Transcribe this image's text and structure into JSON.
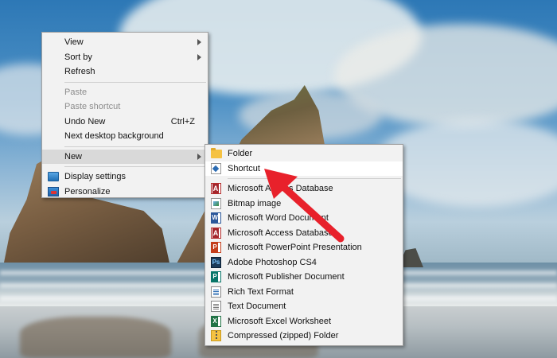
{
  "context_menu": {
    "items": [
      {
        "label": "View",
        "submenu": true
      },
      {
        "label": "Sort by",
        "submenu": true
      },
      {
        "label": "Refresh"
      },
      {
        "label": "Paste",
        "disabled": true
      },
      {
        "label": "Paste shortcut",
        "disabled": true
      },
      {
        "label": "Undo New",
        "shortcut": "Ctrl+Z"
      },
      {
        "label": "Next desktop background"
      },
      {
        "label": "New",
        "submenu": true,
        "highlighted": true
      },
      {
        "label": "Display settings",
        "icon": "display-settings-icon"
      },
      {
        "label": "Personalize",
        "icon": "personalize-icon"
      }
    ]
  },
  "new_submenu": {
    "items": [
      {
        "label": "Folder",
        "icon": "folder-icon"
      },
      {
        "label": "Shortcut",
        "icon": "shortcut-icon",
        "highlighted": true
      },
      {
        "label": "Microsoft Access Database",
        "icon": "access-database-icon"
      },
      {
        "label": "Bitmap image",
        "icon": "bitmap-image-icon"
      },
      {
        "label": "Microsoft Word Document",
        "icon": "word-document-icon"
      },
      {
        "label": "Microsoft Access Database",
        "icon": "access-database-icon"
      },
      {
        "label": "Microsoft PowerPoint Presentation",
        "icon": "powerpoint-icon"
      },
      {
        "label": "Adobe Photoshop CS4",
        "icon": "photoshop-icon"
      },
      {
        "label": "Microsoft Publisher Document",
        "icon": "publisher-icon"
      },
      {
        "label": "Rich Text Format",
        "icon": "rich-text-icon"
      },
      {
        "label": "Text Document",
        "icon": "text-document-icon"
      },
      {
        "label": "Microsoft Excel Worksheet",
        "icon": "excel-worksheet-icon"
      },
      {
        "label": "Compressed (zipped) Folder",
        "icon": "zipped-folder-icon"
      }
    ]
  },
  "annotation": {
    "color": "#e8212b",
    "icon": "red-arrow-pointer-icon"
  },
  "photoshop_icon_text": "Ps"
}
